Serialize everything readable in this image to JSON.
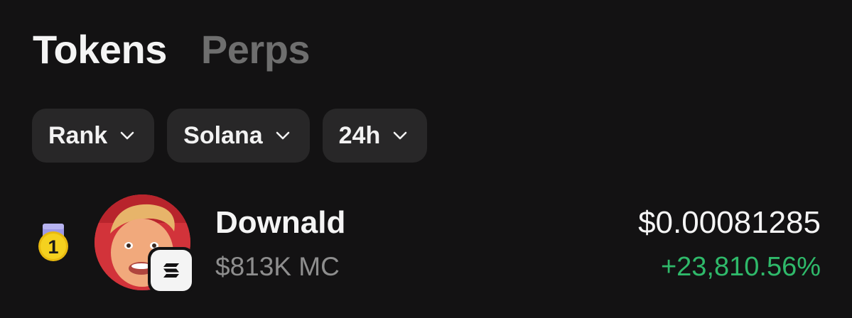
{
  "tabs": [
    {
      "label": "Tokens",
      "active": true
    },
    {
      "label": "Perps",
      "active": false
    }
  ],
  "filters": [
    {
      "label": "Rank",
      "icon": "chevron-down-icon"
    },
    {
      "label": "Solana",
      "icon": "chevron-down-icon"
    },
    {
      "label": "24h",
      "icon": "chevron-down-icon"
    }
  ],
  "tokens": [
    {
      "rank": "1",
      "name": "Downald",
      "market_cap": "$813K MC",
      "price": "$0.00081285",
      "change": "+23,810.56%",
      "chain_icon": "solana-icon",
      "avatar": "token-avatar"
    }
  ],
  "colors": {
    "background": "#131213",
    "chip": "#282728",
    "positive": "#2fb96a",
    "muted": "#8e8e8e",
    "medal_gold": "#f3cc1d",
    "medal_ribbon": "#9d98e6"
  }
}
